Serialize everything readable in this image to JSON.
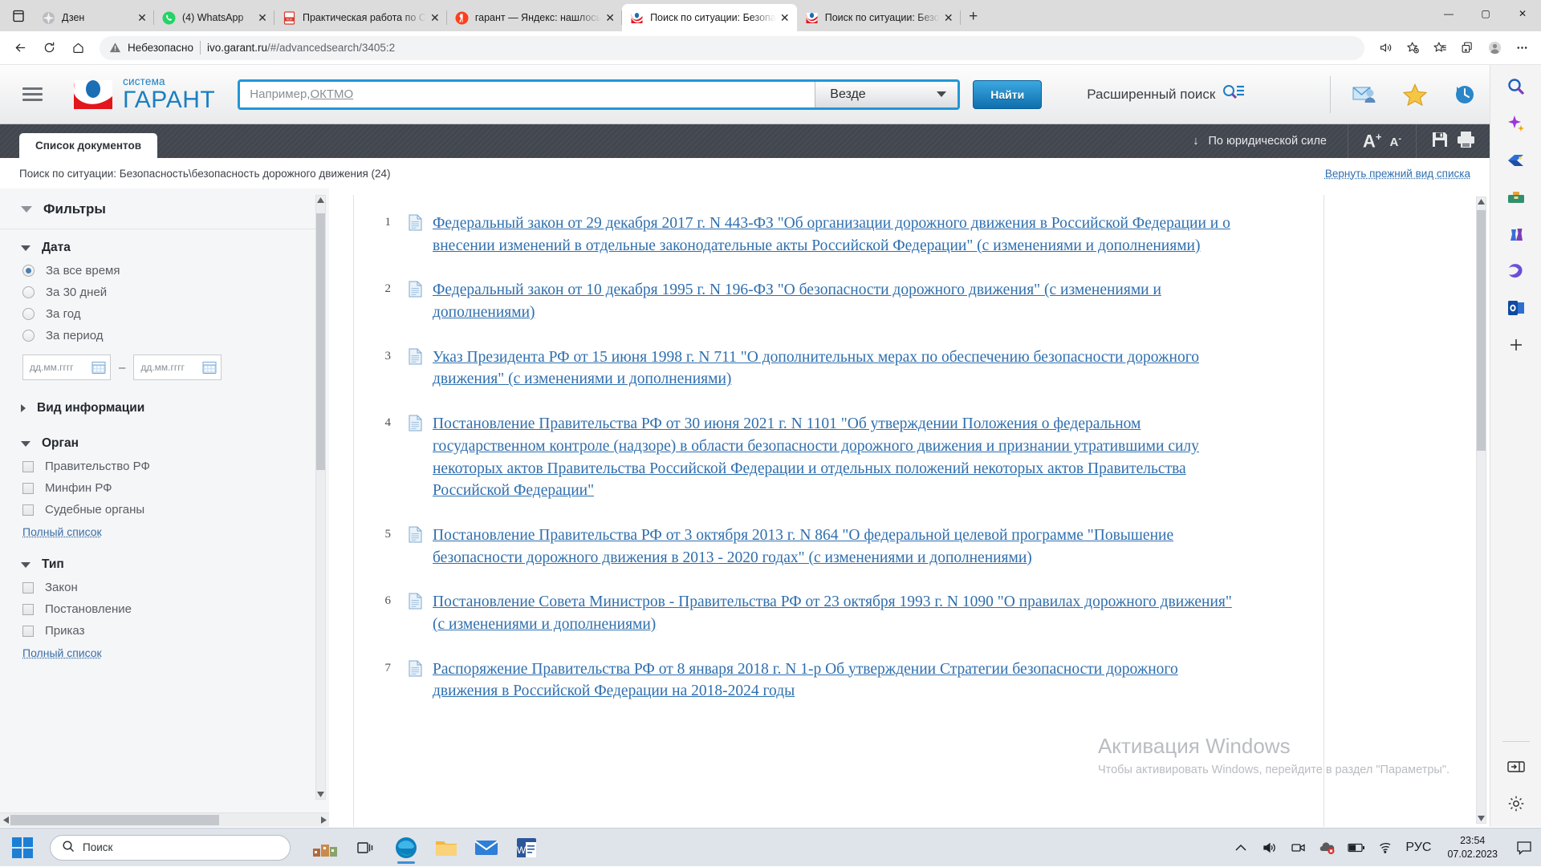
{
  "browser": {
    "tabs": [
      {
        "title": "Дзен",
        "favicon": "zen-icon",
        "active": false
      },
      {
        "title": "(4) WhatsApp",
        "favicon": "whatsapp-icon",
        "active": false
      },
      {
        "title": "Практическая работа по С",
        "favicon": "pdf-icon",
        "active": false
      },
      {
        "title": "гарант — Яндекс: нашлось",
        "favicon": "yandex-icon",
        "active": false
      },
      {
        "title": "Поиск по ситуации: Безопа",
        "favicon": "garant-icon",
        "active": true
      },
      {
        "title": "Поиск по ситуации: Безо",
        "favicon": "garant-icon",
        "active": false
      }
    ],
    "new_tab_label": "+",
    "window_controls": {
      "minimize": "—",
      "maximize": "▢",
      "close": "✕"
    },
    "nav": {
      "back": "back-icon",
      "reload": "reload-icon",
      "home": "home-icon"
    },
    "omnibox": {
      "security_label": "Небезопасно",
      "url_domain": "ivo.garant.ru",
      "url_path": "/#/advancedsearch/3405:2"
    },
    "toolbar_icons": [
      "read-aloud-icon",
      "add-favorite-icon",
      "favorites-icon",
      "collections-icon",
      "profile-icon",
      "settings-more-icon"
    ]
  },
  "garant": {
    "logo": {
      "line1": "система",
      "line2": "ГАРАНТ"
    },
    "search": {
      "placeholder_prefix": "Например, ",
      "placeholder_link": "ОКТМО",
      "scope_value": "Везде",
      "find_button": "Найти"
    },
    "advanced_search_label": "Расширенный поиск",
    "header_icons": [
      "mail-user-icon",
      "star-icon",
      "history-icon"
    ],
    "toolbar": {
      "tab_label": "Список документов",
      "sort_label": "По юридической силе",
      "sort_arrow": "↓",
      "font_increase": "A+",
      "font_decrease": "A-",
      "save_icon": "save-icon",
      "print_icon": "print-icon"
    },
    "breadcrumb": "Поиск по ситуации: Безопасность\\безопасность дорожного движения (24)",
    "restore_link": "Вернуть прежний вид списка"
  },
  "filters": {
    "title": "Фильтры",
    "groups": [
      {
        "name": "Дата",
        "expanded": true,
        "control": "radio",
        "options": [
          {
            "label": "За все время",
            "checked": true
          },
          {
            "label": "За 30 дней",
            "checked": false
          },
          {
            "label": "За год",
            "checked": false
          },
          {
            "label": "За период",
            "checked": false
          }
        ],
        "date_from_placeholder": "дд.мм.гггг",
        "date_to_placeholder": "дд.мм.гггг",
        "date_separator": "–"
      },
      {
        "name": "Вид информации",
        "expanded": false,
        "control": "none",
        "options": []
      },
      {
        "name": "Орган",
        "expanded": true,
        "control": "checkbox",
        "options": [
          {
            "label": "Правительство РФ",
            "checked": false
          },
          {
            "label": "Минфин РФ",
            "checked": false
          },
          {
            "label": "Судебные органы",
            "checked": false
          }
        ],
        "full_list_label": "Полный список"
      },
      {
        "name": "Тип",
        "expanded": true,
        "control": "checkbox",
        "options": [
          {
            "label": "Закон",
            "checked": false
          },
          {
            "label": "Постановление",
            "checked": false
          },
          {
            "label": "Приказ",
            "checked": false
          }
        ],
        "full_list_label": "Полный список"
      }
    ]
  },
  "results": {
    "documents": [
      {
        "num": "1",
        "title": "Федеральный закон от 29 декабря 2017 г. N 443-ФЗ \"Об организации дорожного движения в Российской Федерации и о внесении изменений в отдельные законодательные акты Российской Федерации\" (с изменениями и дополнениями)"
      },
      {
        "num": "2",
        "title": "Федеральный закон от 10 декабря 1995 г. N 196-ФЗ \"О безопасности дорожного движения\" (с изменениями и дополнениями)"
      },
      {
        "num": "3",
        "title": "Указ Президента РФ от 15 июня 1998 г. N 711 \"О дополнительных мерах по обеспечению безопасности дорожного движения\" (с изменениями и дополнениями)"
      },
      {
        "num": "4",
        "title": "Постановление Правительства РФ от 30 июня 2021 г. N 1101 \"Об утверждении Положения о федеральном государственном контроле (надзоре) в области безопасности дорожного движения и признании утратившими силу некоторых актов Правительства Российской Федерации и отдельных положений некоторых актов Правительства Российской Федерации\""
      },
      {
        "num": "5",
        "title": "Постановление Правительства РФ от 3 октября 2013 г. N 864 \"О федеральной целевой программе \"Повышение безопасности дорожного движения в 2013 - 2020 годах\" (с изменениями и дополнениями)"
      },
      {
        "num": "6",
        "title": "Постановление Совета Министров - Правительства РФ от 23 октября 1993 г. N 1090 \"О правилах дорожного движения\" (с изменениями и дополнениями)"
      },
      {
        "num": "7",
        "title": "Распоряжение Правительства РФ от 8 января 2018 г. N 1-р Об утверждении Стратегии безопасности дорожного движения в Российской Федерации на 2018-2024 годы"
      }
    ]
  },
  "watermark": {
    "line1": "Активация Windows",
    "line2": "Чтобы активировать Windows, перейдите в раздел \"Параметры\"."
  },
  "edge_rail": {
    "icons": [
      "search-icon",
      "copilot-icon",
      "shopping-tag-icon",
      "tools-icon",
      "games-icon",
      "microsoft-365-icon",
      "outlook-icon",
      "add-icon"
    ],
    "bottom_icons": [
      "sidebar-toggle-icon",
      "settings-gear-icon"
    ]
  },
  "taskbar": {
    "start_label": "start-icon",
    "search_placeholder": "Поиск",
    "apps": [
      "task-view-icon",
      "edge-icon",
      "explorer-icon",
      "mail-icon",
      "word-icon"
    ],
    "tray": [
      "chevron-up-icon",
      "volume-icon",
      "camera-icon",
      "onedrive-error-icon",
      "battery-icon",
      "wifi-icon"
    ],
    "language": "РУС",
    "time": "23:54",
    "date": "07.02.2023",
    "notification": "notification-icon"
  },
  "colors": {
    "accent_blue": "#2f6fae",
    "garant_blue": "#1a7fc1",
    "garant_red": "#e2161c",
    "dark_toolbar": "#41464f",
    "taskbar": "#dfe3ea"
  }
}
